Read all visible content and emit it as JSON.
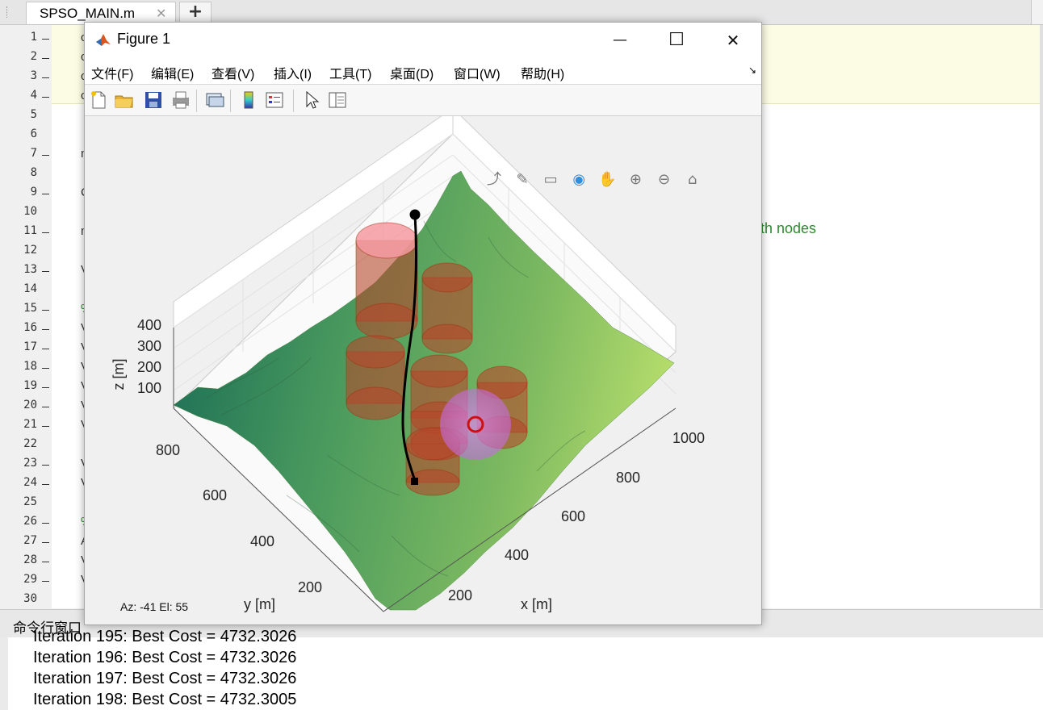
{
  "editor": {
    "tab_label": "SPSO_MAIN.m",
    "tab_close": "✕",
    "tab_add": "+",
    "line_numbers": [
      "1",
      "2",
      "3",
      "4",
      "5",
      "6",
      "7",
      "8",
      "9",
      "10",
      "11",
      "12",
      "13",
      "14",
      "15",
      "16",
      "17",
      "18",
      "19",
      "20",
      "21",
      "22",
      "23",
      "24",
      "25",
      "26",
      "27",
      "28",
      "29",
      "30"
    ],
    "code_fragments": {
      "l1": "c",
      "l2": "c",
      "l3": "c",
      "l4": "c",
      "l7": "m",
      "l9": "C",
      "l11": "m",
      "l13": "V",
      "l15": "%",
      "l16": "V",
      "l17": "V",
      "l18": "V",
      "l19": "V",
      "l20": "V",
      "l21": "V",
      "l23": "V",
      "l24": "V",
      "l26": "%",
      "l27": "A",
      "l28": "V",
      "l29": "V"
    },
    "path_comment": "th nodes"
  },
  "command_window": {
    "title": "命令行窗口",
    "lines": [
      "Iteration 195: Best Cost = 4732.3026",
      "Iteration 196: Best Cost = 4732.3026",
      "Iteration 197: Best Cost = 4732.3026",
      "Iteration 198: Best Cost = 4732.3005"
    ]
  },
  "figure": {
    "title": "Figure 1",
    "window_buttons": {
      "minimize": "—",
      "maximize": "☐",
      "close": "✕"
    },
    "menus": [
      "文件(F)",
      "编辑(E)",
      "查看(V)",
      "插入(I)",
      "工具(T)",
      "桌面(D)",
      "窗口(W)",
      "帮助(H)"
    ],
    "menu_arrow": "↘",
    "toolbar_icons": [
      "new-file-icon",
      "open-folder-icon",
      "save-icon",
      "print-icon",
      "link-plot-icon",
      "colorbar-icon",
      "legend-icon",
      "pointer-icon",
      "property-inspector-icon"
    ],
    "axes_toolbar_icons": [
      "export-icon",
      "brush-icon",
      "datatip-icon",
      "rotate-3d-icon",
      "pan-icon",
      "zoom-in-icon",
      "zoom-out-icon",
      "home-icon"
    ],
    "az_el": "Az:  -41 El:   55"
  },
  "chart_data": {
    "type": "surface3d",
    "xlabel": "x [m]",
    "ylabel": "y [m]",
    "zlabel": "z [m]",
    "x_ticks": [
      "200",
      "400",
      "600",
      "800",
      "1000"
    ],
    "y_ticks": [
      "200",
      "400",
      "600",
      "800"
    ],
    "z_ticks": [
      "100",
      "200",
      "300",
      "400"
    ],
    "view": {
      "azimuth": -41,
      "elevation": 55
    },
    "colormap": "summer",
    "obstacles": [
      {
        "type": "cylinder",
        "color": "#cc3322",
        "count": 8
      },
      {
        "type": "sphere",
        "color": "#e060e0",
        "count": 1
      }
    ],
    "path": {
      "color": "#000000",
      "start_marker": "square",
      "end_marker": "circle"
    }
  },
  "colors": {
    "path": "#000000",
    "cylinder": "#c0442a",
    "sphere": "#e15ee6",
    "terrain_low": "#1e7a5a",
    "terrain_high": "#b8e070"
  }
}
